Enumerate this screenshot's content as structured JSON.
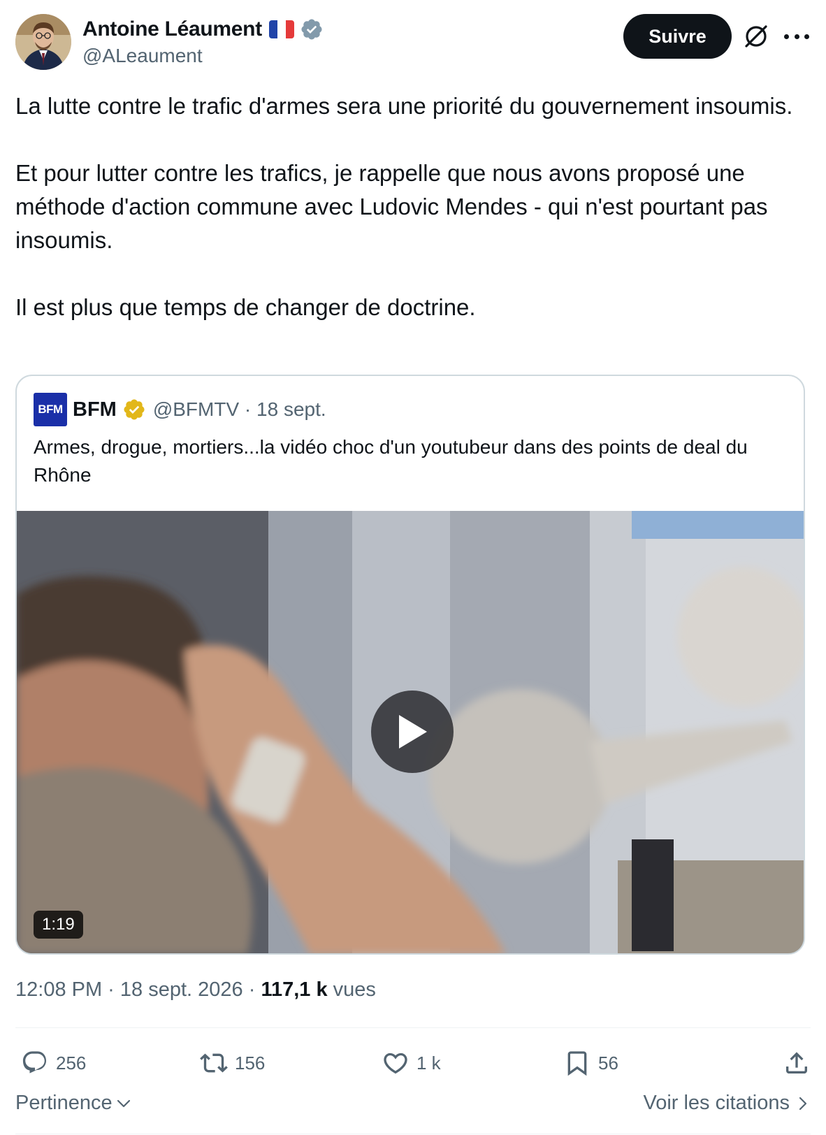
{
  "author": {
    "display_name": "Antoine Léaument",
    "handle": "@ALeaument",
    "flag": "france-flag",
    "verified": true
  },
  "header": {
    "follow_label": "Suivre",
    "grok_icon": "grok-icon",
    "more_icon": "more-options-icon"
  },
  "tweet": {
    "paragraphs": [
      "La lutte contre le trafic d'armes sera une priorité du gouvernement insoumis.",
      "Et pour lutter contre les trafics, je rappelle que nous avons proposé une méthode d'action commune avec Ludovic Mendes - qui n'est pourtant pas insoumis.",
      "Il est plus que temps de changer de doctrine."
    ]
  },
  "quote": {
    "logo_text": "BFM",
    "name": "BFM",
    "handle_date": "@BFMTV · 18 sept.",
    "text": "Armes, drogue, mortiers...la vidéo choc d'un youtubeur dans des points de deal du Rhône",
    "video_duration": "1:19"
  },
  "meta": {
    "time_date": "12:08 PM · 18 sept. 2026 · ",
    "views_count": "117,1 k",
    "views_label": " vues"
  },
  "actions": {
    "replies": "256",
    "reposts": "156",
    "likes": "1 k",
    "bookmarks": "56"
  },
  "footer": {
    "sort_label": "Pertinence",
    "quotes_label": "Voir les citations"
  },
  "colors": {
    "text": "#0f1419",
    "secondary": "#536471",
    "border": "#cfd9de",
    "verified_blue": "#829aab",
    "gold": "#e2b719",
    "bfm_blue": "#1a2fa8"
  }
}
